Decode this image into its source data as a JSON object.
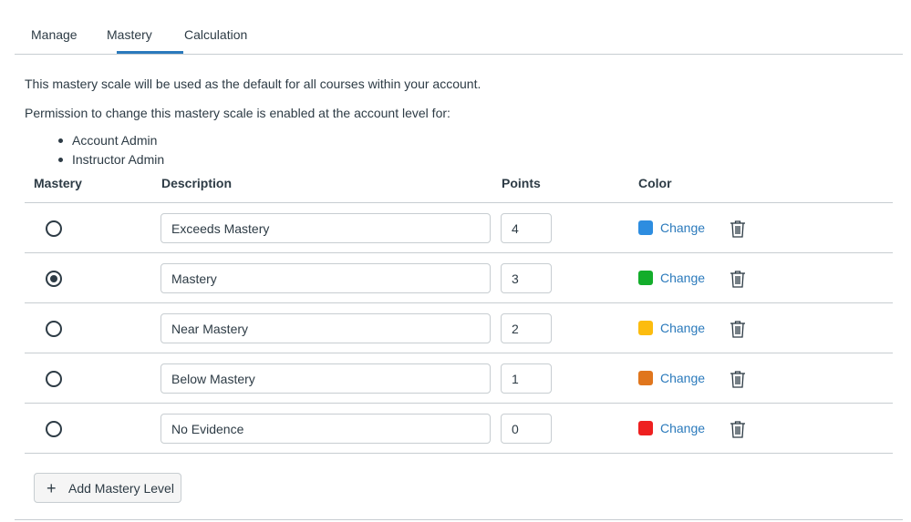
{
  "tabs": [
    {
      "label": "Manage",
      "active": false
    },
    {
      "label": "Mastery",
      "active": true
    },
    {
      "label": "Calculation",
      "active": false
    }
  ],
  "intro_text": "This mastery scale will be used as the default for all courses within your account.",
  "permission_text": "Permission to change this mastery scale is enabled at the account level for:",
  "roles": [
    "Account Admin",
    "Instructor Admin"
  ],
  "table": {
    "headers": {
      "mastery": "Mastery",
      "description": "Description",
      "points": "Points",
      "color": "Color"
    },
    "rows": [
      {
        "description": "Exceeds Mastery",
        "points": "4",
        "color": "#2d8de0",
        "change_label": "Change",
        "is_mastery": false
      },
      {
        "description": "Mastery",
        "points": "3",
        "color": "#13ad2b",
        "change_label": "Change",
        "is_mastery": true
      },
      {
        "description": "Near Mastery",
        "points": "2",
        "color": "#fcbc0f",
        "change_label": "Change",
        "is_mastery": false
      },
      {
        "description": "Below Mastery",
        "points": "1",
        "color": "#e0761d",
        "change_label": "Change",
        "is_mastery": false
      },
      {
        "description": "No Evidence",
        "points": "0",
        "color": "#ee2020",
        "change_label": "Change",
        "is_mastery": false
      }
    ]
  },
  "add_button": {
    "icon": "plus-icon",
    "label": "Add Mastery Level"
  },
  "colors": {
    "accent": "#2b7abc",
    "text": "#2d3b45",
    "border": "#c7cdd1"
  }
}
